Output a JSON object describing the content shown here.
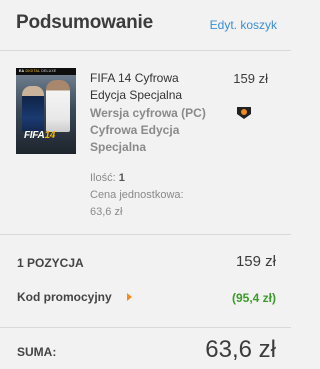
{
  "header": {
    "title": "Podsumowanie",
    "edit_link": "Edyt. koszyk"
  },
  "item": {
    "cover": {
      "band_brand": "EA",
      "band_text": "DIGITAL",
      "band_text2": "DELUXE",
      "logo_text": "FIFA",
      "logo_num": "14"
    },
    "name": "FIFA 14 Cyfrowa Edycja Specjalna",
    "variant": "Wersja cyfrowa (PC) Cyfrowa Edycja Specjalna",
    "price": "159 zł",
    "remove_icon": "remove-icon",
    "qty_label": "Ilość:",
    "qty_value": "1",
    "unit_price_label": "Cena jednostkowa:",
    "unit_price_value": "63,6 zł"
  },
  "summary": {
    "count_label": "1 POZYCJA",
    "count_value": "159 zł",
    "promo_label": "Kod promocyjny",
    "promo_value": "(95,4 zł)",
    "total_label": "SUMA:",
    "total_value": "63,6 zł"
  },
  "colors": {
    "link": "#3a8fd6",
    "promo_green": "#3c9b2a",
    "caret_orange": "#f28c1c"
  }
}
